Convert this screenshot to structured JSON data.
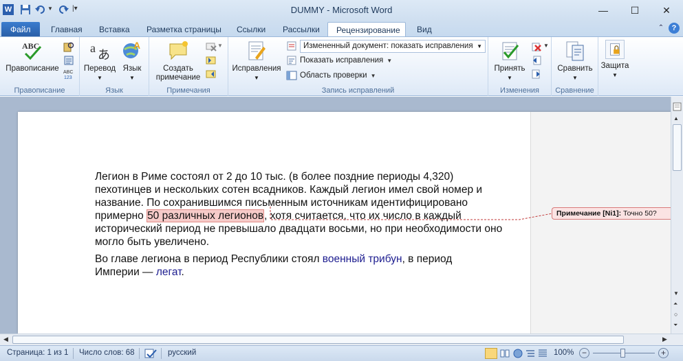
{
  "window": {
    "title": "DUMMY  -  Microsoft Word",
    "minimize": "—",
    "maximize": "☐",
    "close": "✕"
  },
  "tabs": [
    "Файл",
    "Главная",
    "Вставка",
    "Разметка страницы",
    "Ссылки",
    "Рассылки",
    "Рецензирование",
    "Вид"
  ],
  "active_tab": "Рецензирование",
  "ribbon": {
    "spelling": {
      "label": "Правописание",
      "group": "Правописание"
    },
    "language": {
      "translate": "Перевод",
      "language": "Язык",
      "group": "Язык"
    },
    "comments": {
      "create": "Создать примечание",
      "group": "Примечания"
    },
    "tracking": {
      "track": "Исправления",
      "display_select": "Измененный документ: показать исправления",
      "show_markup": "Показать исправления",
      "review_pane": "Область проверки",
      "group": "Запись исправлений"
    },
    "changes": {
      "accept": "Принять",
      "group": "Изменения"
    },
    "compare": {
      "compare": "Сравнить",
      "group": "Сравнение"
    },
    "protect": {
      "protect": "Защита"
    }
  },
  "document": {
    "p1_lines": [
      "Легион в Риме состоял от 2 до 10 тыс. (в более поздние периоды 4,320)",
      "пехотинцев и нескольких сотен всадников. Каждый легион имел свой номер и",
      "название. По сохранившимся письменным источникам идентифицировано"
    ],
    "p1_line4_pre": "примерно ",
    "p1_highlight": "50 различных легионов",
    "p1_line4_post": ", хотя считается, что их число в каждый",
    "p1_lines_tail": [
      "исторический период не превышало двадцати восьми, но при необходимости оно",
      "могло быть увеличено."
    ],
    "p2_line1_pre": "Во главе легиона в период Республики стоял ",
    "p2_link1": "военный трибун",
    "p2_line1_post": ", в период",
    "p2_line2_pre": "Империи — ",
    "p2_link2": "легат",
    "p2_line2_post": "."
  },
  "comment": {
    "label": "Примечание [Ni1]:",
    "text": " Точно 50?"
  },
  "status": {
    "page": "Страница: 1 из 1",
    "words": "Число слов: 68",
    "language": "русский",
    "zoom": "100%"
  }
}
